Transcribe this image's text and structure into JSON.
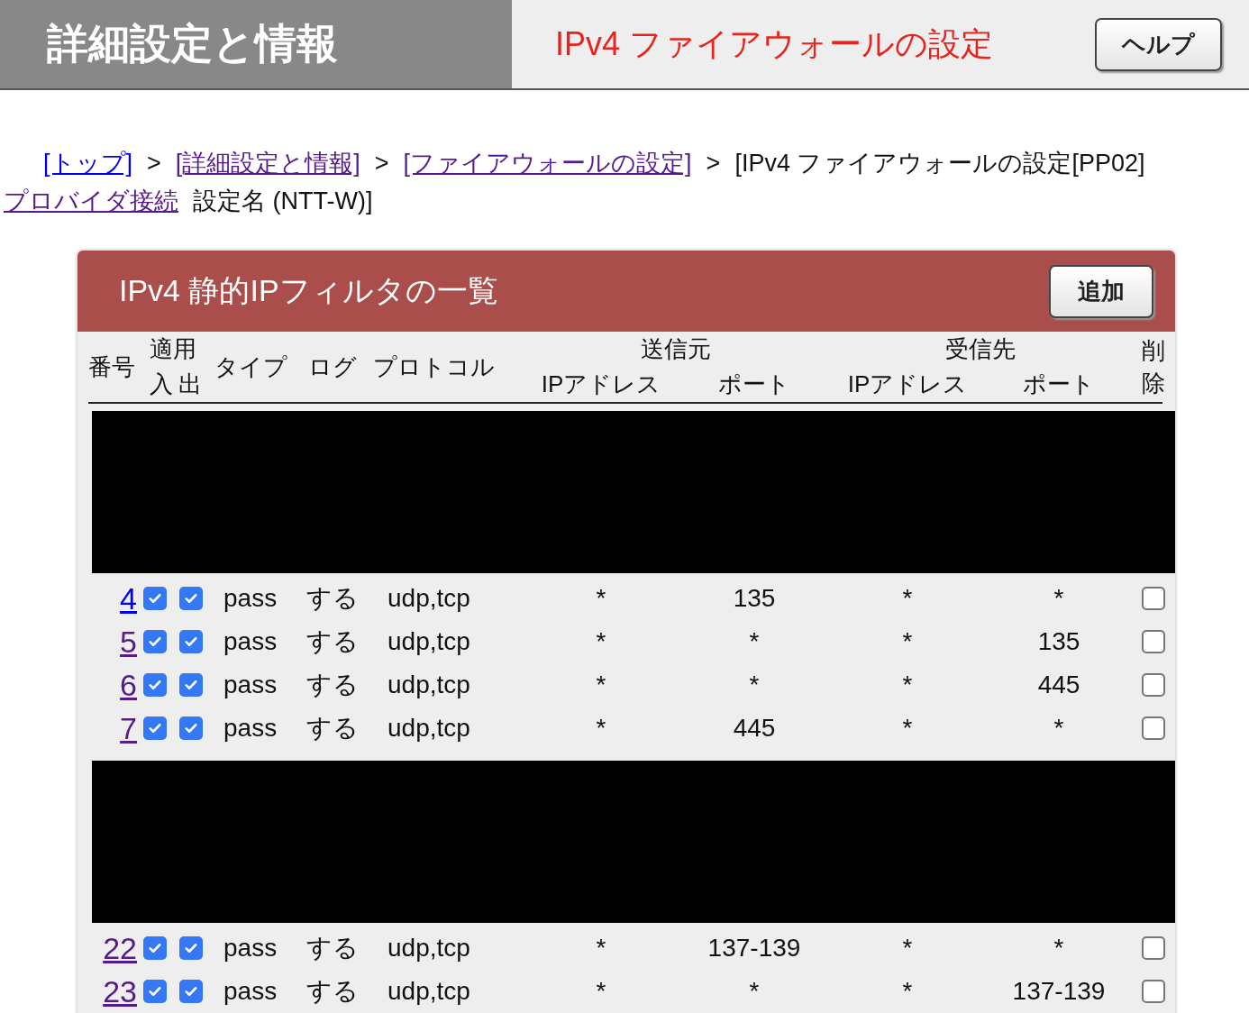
{
  "header": {
    "section_title": "詳細設定と情報",
    "page_title": "IPv4 ファイアウォールの設定",
    "help_button": "ヘルプ"
  },
  "breadcrumb": [
    {
      "kind": "link",
      "text": "[トップ]",
      "visited": false
    },
    {
      "kind": "separator",
      "text": ">"
    },
    {
      "kind": "link",
      "text": "[詳細設定と情報]",
      "visited": true
    },
    {
      "kind": "separator",
      "text": ">"
    },
    {
      "kind": "link",
      "text": "[ファイアウォールの設定]",
      "visited": true
    },
    {
      "kind": "separator",
      "text": ">"
    },
    {
      "kind": "text",
      "text": "[IPv4 ファイアウォールの設定[PP02]"
    },
    {
      "kind": "link",
      "text": "プロバイダ接続",
      "visited": true
    },
    {
      "kind": "text",
      "text": "設定名 (NTT-W)]"
    }
  ],
  "panel": {
    "title": "IPv4 静的IPフィルタの一覧",
    "add_button": "追加",
    "headers": {
      "number": "番号",
      "apply": "適用",
      "in": "入",
      "out": "出",
      "type": "タイプ",
      "log": "ログ",
      "protocol": "プロトコル",
      "source": "送信元",
      "source_ip": "IPアドレス",
      "source_port": "ポート",
      "destination": "受信先",
      "destination_ip": "IPアドレス",
      "destination_port": "ポート",
      "delete": "削除"
    },
    "body": [
      {
        "kind": "redacted"
      },
      {
        "kind": "rows",
        "rows": [
          {
            "number": "4",
            "visited": false,
            "in": true,
            "out": true,
            "type": "pass",
            "log": "する",
            "protocol": "udp,tcp",
            "source_ip": "*",
            "source_port": "135",
            "destination_ip": "*",
            "destination_port": "*",
            "delete": false
          },
          {
            "number": "5",
            "visited": true,
            "in": true,
            "out": true,
            "type": "pass",
            "log": "する",
            "protocol": "udp,tcp",
            "source_ip": "*",
            "source_port": "*",
            "destination_ip": "*",
            "destination_port": "135",
            "delete": false
          },
          {
            "number": "6",
            "visited": true,
            "in": true,
            "out": true,
            "type": "pass",
            "log": "する",
            "protocol": "udp,tcp",
            "source_ip": "*",
            "source_port": "*",
            "destination_ip": "*",
            "destination_port": "445",
            "delete": false
          },
          {
            "number": "7",
            "visited": true,
            "in": true,
            "out": true,
            "type": "pass",
            "log": "する",
            "protocol": "udp,tcp",
            "source_ip": "*",
            "source_port": "445",
            "destination_ip": "*",
            "destination_port": "*",
            "delete": false
          }
        ]
      },
      {
        "kind": "redacted"
      },
      {
        "kind": "rows",
        "rows": [
          {
            "number": "22",
            "visited": true,
            "in": true,
            "out": true,
            "type": "pass",
            "log": "する",
            "protocol": "udp,tcp",
            "source_ip": "*",
            "source_port": "137-139",
            "destination_ip": "*",
            "destination_port": "*",
            "delete": false
          },
          {
            "number": "23",
            "visited": true,
            "in": true,
            "out": true,
            "type": "pass",
            "log": "する",
            "protocol": "udp,tcp",
            "source_ip": "*",
            "source_port": "*",
            "destination_ip": "*",
            "destination_port": "137-139",
            "delete": false
          }
        ]
      }
    ]
  }
}
